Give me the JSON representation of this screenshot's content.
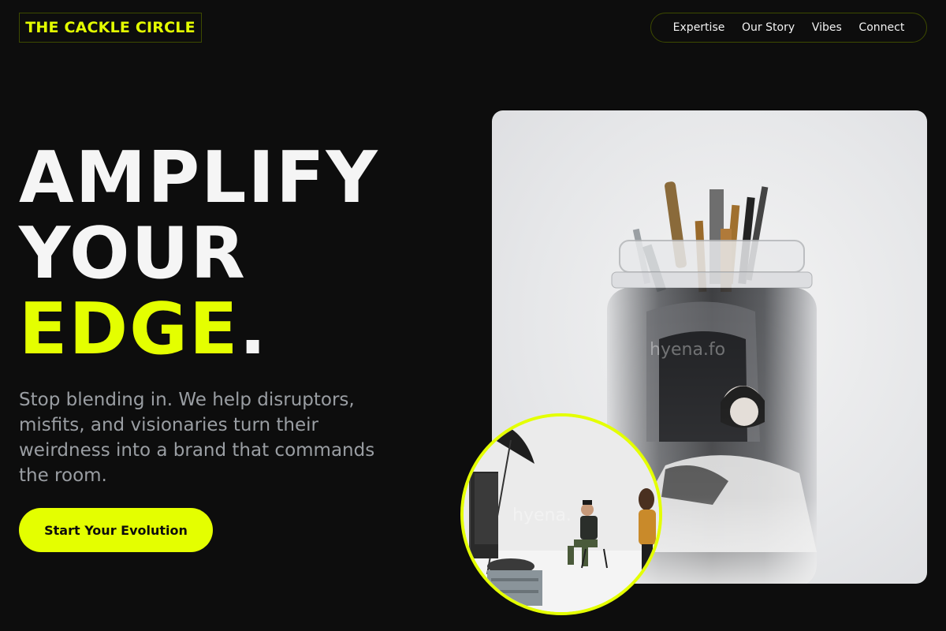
{
  "brand": {
    "logo_text": "THE CACKLE CIRCLE",
    "accent": "#e4ff00",
    "background": "#0d0d0d"
  },
  "nav": {
    "items": [
      {
        "label": "Expertise"
      },
      {
        "label": "Our Story"
      },
      {
        "label": "Vibes"
      },
      {
        "label": "Connect"
      }
    ]
  },
  "hero": {
    "line1": "AMPLIFY",
    "line2": "YOUR",
    "line3": "EDGE",
    "period": ".",
    "subtext": "Stop blending in. We help disruptors, misfits, and visionaries turn their weirdness into a brand that commands the room.",
    "cta_label": "Start Your Evolution"
  },
  "images": {
    "main_watermark": "hyena.fo",
    "circle_watermark": "hyena."
  }
}
